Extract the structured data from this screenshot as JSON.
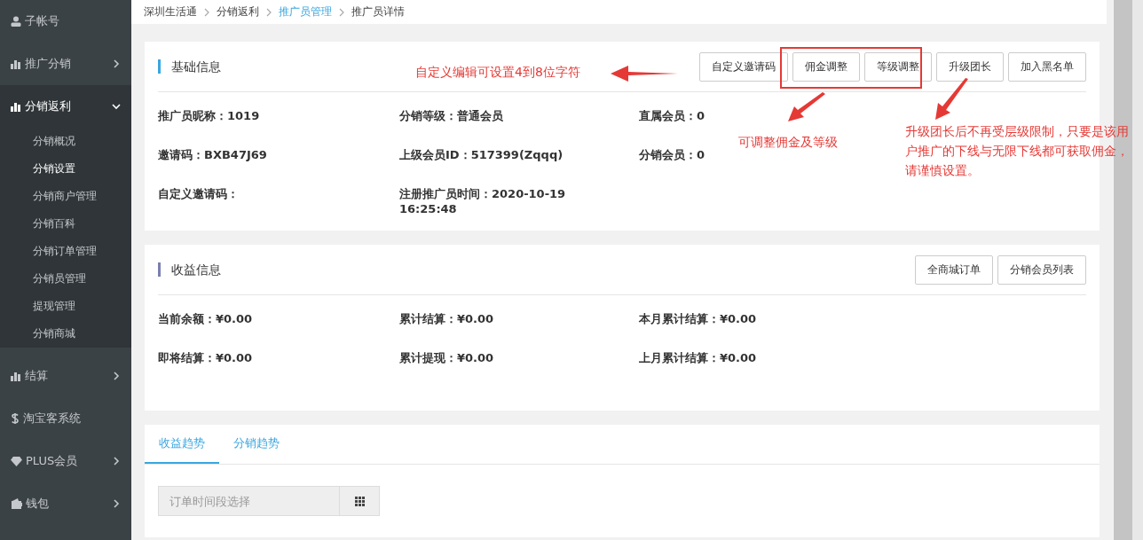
{
  "sidebar": {
    "items": [
      {
        "label": "子帐号",
        "has_arrow": false,
        "expanded": false
      },
      {
        "label": "推广分销",
        "has_arrow": true,
        "expanded": false
      },
      {
        "label": "分销返利",
        "has_arrow": true,
        "expanded": true,
        "children": [
          {
            "label": "分销概况",
            "selected": false
          },
          {
            "label": "分销设置",
            "selected": true
          },
          {
            "label": "分销商户管理",
            "selected": false
          },
          {
            "label": "分销百科",
            "selected": false
          },
          {
            "label": "分销订单管理",
            "selected": false
          },
          {
            "label": "分销员管理",
            "selected": false
          },
          {
            "label": "提现管理",
            "selected": false
          },
          {
            "label": "分销商城",
            "selected": false
          }
        ]
      },
      {
        "label": "结算",
        "has_arrow": true,
        "expanded": false
      },
      {
        "label": "淘宝客系统",
        "has_arrow": false,
        "expanded": false
      },
      {
        "label": "PLUS会员",
        "has_arrow": true,
        "expanded": false
      },
      {
        "label": "钱包",
        "has_arrow": true,
        "expanded": false
      }
    ]
  },
  "breadcrumb": [
    {
      "label": "深圳生活通",
      "kind": "text"
    },
    {
      "label": "分销返利",
      "kind": "text"
    },
    {
      "label": "推广员管理",
      "kind": "link"
    },
    {
      "label": "推广员详情",
      "kind": "text"
    }
  ],
  "basic_info": {
    "title": "基础信息",
    "buttons": [
      "自定义邀请码",
      "佣金调整",
      "等级调整",
      "升级团长",
      "加入黑名单"
    ],
    "fields": [
      [
        "推广员昵称：1019",
        "分销等级：普通会员",
        "直属会员：0"
      ],
      [
        "邀请码：BXB47J69",
        "上级会员ID：517399(Zqqq)",
        "分销会员：0"
      ],
      [
        "自定义邀请码：",
        "注册推广员时间：2020-10-19 16:25:48"
      ]
    ]
  },
  "income_info": {
    "title": "收益信息",
    "buttons": [
      "全商城订单",
      "分销会员列表"
    ],
    "fields": [
      [
        "当前余额：¥0.00",
        "累计结算：¥0.00",
        "本月累计结算：¥0.00"
      ],
      [
        "即将结算：¥0.00",
        "累计提现：¥0.00",
        "上月累计结算：¥0.00"
      ]
    ]
  },
  "trend": {
    "tabs": [
      {
        "label": "收益趋势",
        "selected": true
      },
      {
        "label": "分销趋势",
        "selected": false
      }
    ],
    "date_field": {
      "placeholder": "订单时间段选择"
    }
  },
  "annotations": [
    "自定义编辑可设置4到8位字符",
    "可调整佣金及等级",
    "升级团长后不再受层级限制，只要是该用户推广的下线与无限下线都可获取佣金，请谨慎设置。"
  ]
}
